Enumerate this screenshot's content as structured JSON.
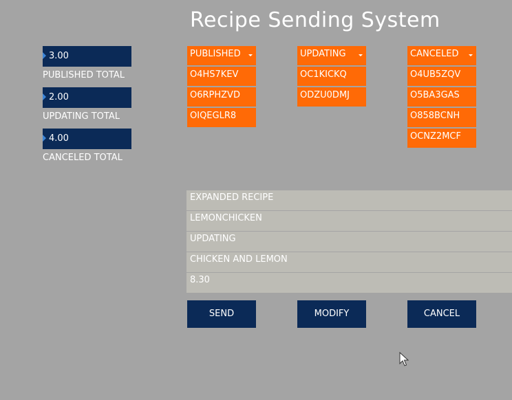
{
  "title": "Recipe Sending System",
  "totals": [
    {
      "value": "3.00",
      "label": "PUBLISHED TOTAL"
    },
    {
      "value": "2.00",
      "label": "UPDATING TOTAL"
    },
    {
      "value": "4.00",
      "label": "CANCELED TOTAL"
    }
  ],
  "columns": {
    "published": {
      "header": "PUBLISHED",
      "items": [
        "O4HS7KEV",
        "O6RPHZVD",
        "OIQEGLR8"
      ]
    },
    "updating": {
      "header": "UPDATING",
      "items": [
        "OC1KICKQ",
        "ODZU0DMJ"
      ]
    },
    "canceled": {
      "header": "CANCELED",
      "items": [
        "O4UB5ZQV",
        "O5BA3GAS",
        "O858BCNH",
        "OCNZ2MCF"
      ]
    }
  },
  "expanded": {
    "heading": "EXPANDED RECIPE",
    "name": "LEMONCHICKEN",
    "status": "UPDATING",
    "ingredients": "CHICKEN AND LEMON",
    "price": "8.30"
  },
  "buttons": {
    "send": "SEND",
    "modify": "MODIFY",
    "cancel": "CANCEL"
  },
  "colors": {
    "background": "#a4a4a4",
    "navy": "#0b2a57",
    "orange": "#ff6a06",
    "panel": "#bdbcb5"
  }
}
